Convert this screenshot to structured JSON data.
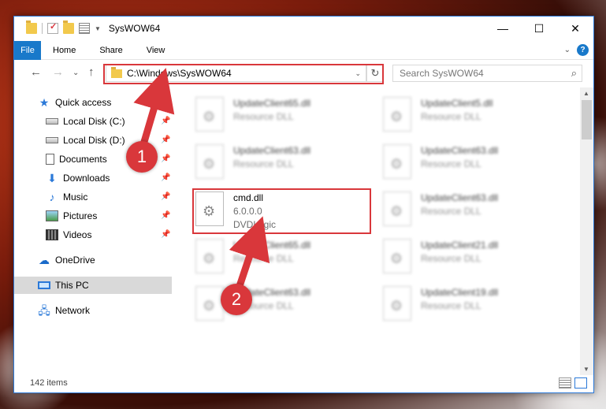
{
  "window": {
    "title": "SysWOW64"
  },
  "title_controls": {
    "minimize": "—",
    "maximize": "☐",
    "close": "✕"
  },
  "ribbon": {
    "file": "File",
    "home": "Home",
    "share": "Share",
    "view": "View",
    "expand": "⌄",
    "help": "?"
  },
  "nav": {
    "back": "←",
    "forward": "→",
    "recent": "⌄",
    "up": "↑",
    "refresh": "↻"
  },
  "address": {
    "path": "C:\\Windows\\SysWOW64",
    "dropdown": "⌄"
  },
  "search": {
    "placeholder": "Search SysWOW64",
    "icon": "⌕"
  },
  "sidebar": {
    "items": [
      {
        "label": "Quick access",
        "icon": "star-icon",
        "pinned": false
      },
      {
        "label": "Local Disk (C:)",
        "icon": "drive-icon",
        "pinned": true
      },
      {
        "label": "Local Disk (D:)",
        "icon": "drive-icon",
        "pinned": true
      },
      {
        "label": "Documents",
        "icon": "documents-icon",
        "pinned": true
      },
      {
        "label": "Downloads",
        "icon": "download-icon",
        "pinned": true
      },
      {
        "label": "Music",
        "icon": "music-icon",
        "pinned": true
      },
      {
        "label": "Pictures",
        "icon": "pictures-icon",
        "pinned": true
      },
      {
        "label": "Videos",
        "icon": "videos-icon",
        "pinned": true
      },
      {
        "label": "OneDrive",
        "icon": "cloud-icon",
        "pinned": false
      },
      {
        "label": "This PC",
        "icon": "computer-icon",
        "pinned": false,
        "selected": true
      },
      {
        "label": "Network",
        "icon": "network-icon",
        "pinned": false
      }
    ],
    "pin_glyph": "📌"
  },
  "files": [
    {
      "name": "UpdateClient65.dll",
      "line2": "Resource DLL",
      "blurred": true
    },
    {
      "name": "UpdateClient5.dll",
      "line2": "Resource DLL",
      "blurred": true
    },
    {
      "name": "UpdateClient63.dll",
      "line2": "Resource DLL",
      "blurred": true
    },
    {
      "name": "UpdateClient63.dll",
      "line2": "Resource DLL",
      "blurred": true
    },
    {
      "name": "cmd.dll",
      "line2": "6.0.0.0",
      "line3": "DVDLogic",
      "blurred": false
    },
    {
      "name": "UpdateClient63.dll",
      "line2": "Resource DLL",
      "blurred": true
    },
    {
      "name": "UpdateClient65.dll",
      "line2": "Resource DLL",
      "blurred": true
    },
    {
      "name": "UpdateClient21.dll",
      "line2": "Resource DLL",
      "blurred": true
    },
    {
      "name": "UpdateClient63.dll",
      "line2": "Resource DLL",
      "blurred": true
    },
    {
      "name": "UpdateClient19.dll",
      "line2": "Resource DLL",
      "blurred": true
    }
  ],
  "status": {
    "item_count": "142 items"
  },
  "scroll": {
    "up": "▲",
    "down": "▼"
  },
  "callouts": {
    "one": "1",
    "two": "2"
  },
  "colors": {
    "accent": "#1979ca",
    "highlight": "#d9373b",
    "selection": "#d9d9d9"
  }
}
